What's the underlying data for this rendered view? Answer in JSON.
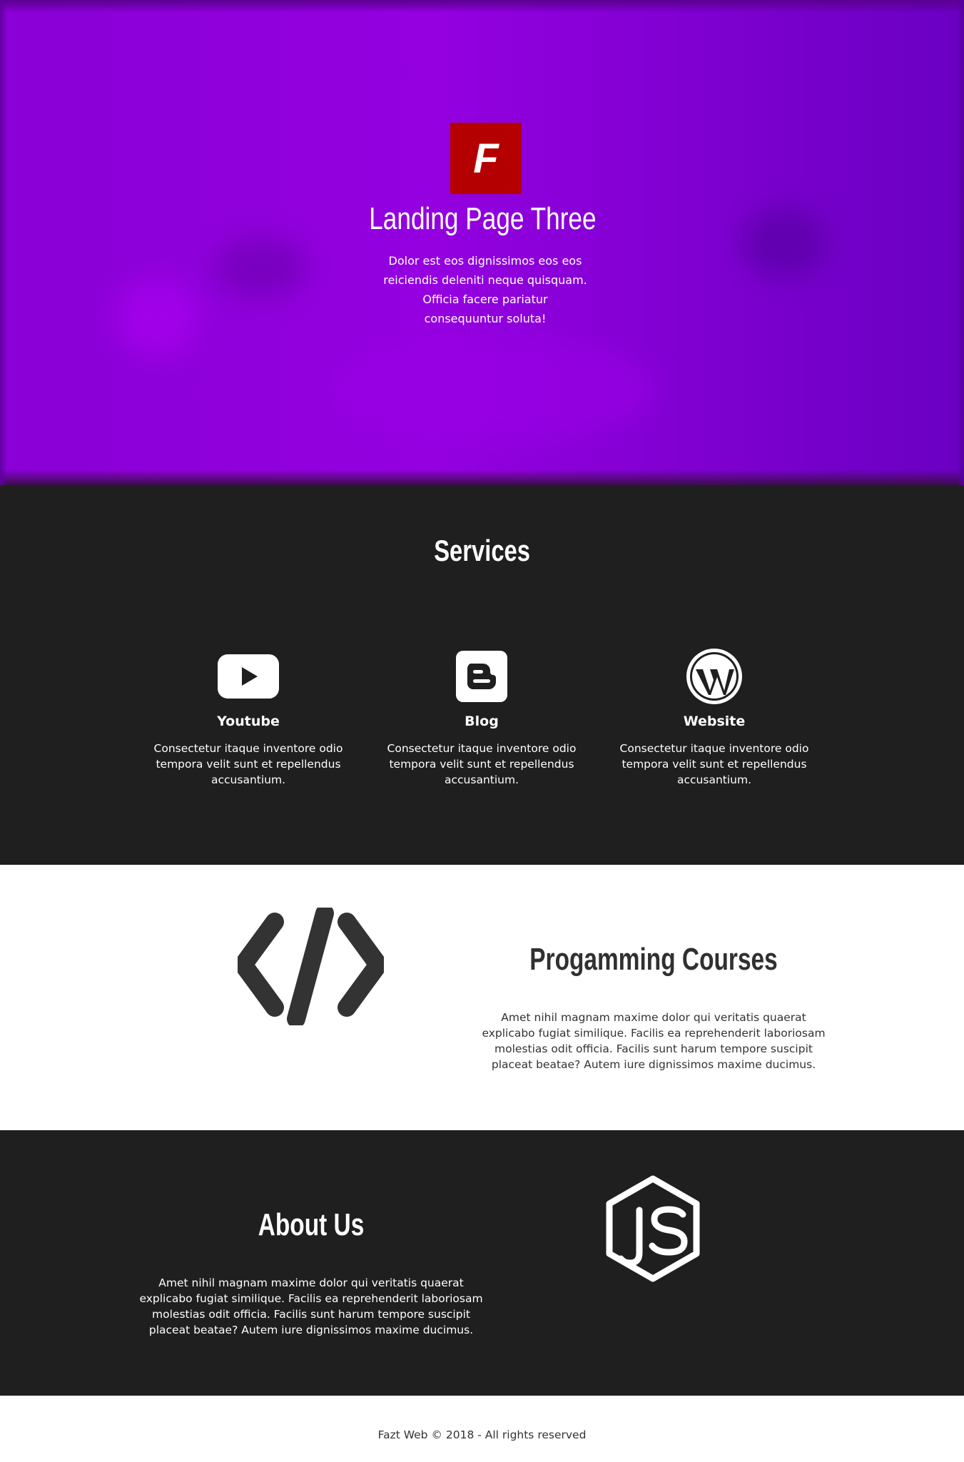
{
  "hero": {
    "logo_letter": "F",
    "title": "Landing Page Three",
    "text": "Dolor est eos dignissimos eos eos reiciendis deleniti neque quisquam. Officia facere pariatur consequuntur soluta!"
  },
  "services": {
    "title": "Services",
    "items": [
      {
        "icon": "youtube-icon",
        "name": "Youtube",
        "description": "Consectetur itaque inventore odio tempora velit sunt et repellendus accusantium."
      },
      {
        "icon": "blogger-icon",
        "name": "Blog",
        "description": "Consectetur itaque inventore odio tempora velit sunt et repellendus accusantium."
      },
      {
        "icon": "wordpress-icon",
        "name": "Website",
        "description": "Consectetur itaque inventore odio tempora velit sunt et repellendus accusantium."
      }
    ]
  },
  "courses": {
    "icon": "code-icon",
    "title": "Progamming Courses",
    "text": "Amet nihil magnam maxime dolor qui veritatis quaerat explicabo fugiat similique. Facilis ea reprehenderit laboriosam molestias odit officia. Facilis sunt harum tempore suscipit placeat beatae? Autem iure dignissimos maxime ducimus."
  },
  "about": {
    "icon": "nodejs-icon",
    "title": "About Us",
    "text": "Amet nihil magnam maxime dolor qui veritatis quaerat explicabo fugiat similique. Facilis ea reprehenderit laboriosam molestias odit officia. Facilis sunt harum tempore suscipit placeat beatae? Autem iure dignissimos maxime ducimus."
  },
  "footer": {
    "text": "Fazt Web © 2018 - All rights reserved"
  },
  "colors": {
    "hero_purple": "#9400e0",
    "logo_red": "#b40000",
    "dark_section": "#1f1f1f",
    "text_dark": "#303030"
  }
}
